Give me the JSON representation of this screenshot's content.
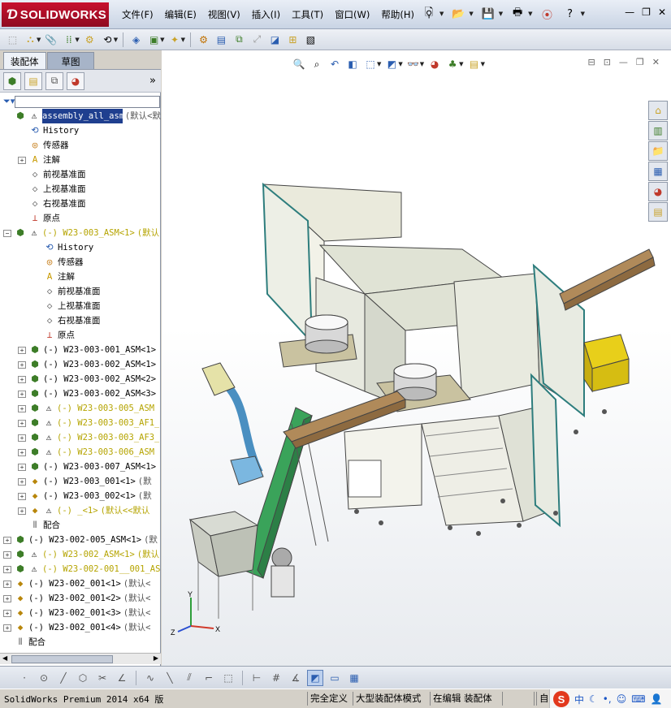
{
  "app": {
    "name": "SOLIDWORKS",
    "brand_color": "#c8102e"
  },
  "menu": {
    "items": [
      "文件(F)",
      "编辑(E)",
      "视图(V)",
      "插入(I)",
      "工具(T)",
      "窗口(W)",
      "帮助(H)"
    ]
  },
  "left_panel": {
    "tabs": [
      "装配体",
      "草图"
    ],
    "active_tab": "装配体",
    "tree": [
      {
        "depth": 0,
        "exp": "",
        "icon": "assembly",
        "warn": true,
        "label": "assembly_all_asm",
        "extra": "(默认<默",
        "selected": true
      },
      {
        "depth": 1,
        "exp": "",
        "icon": "history",
        "label": "History"
      },
      {
        "depth": 1,
        "exp": "",
        "icon": "sensor",
        "label": "传感器"
      },
      {
        "depth": 1,
        "exp": "+",
        "icon": "annotation",
        "label": "注解"
      },
      {
        "depth": 1,
        "exp": "",
        "icon": "plane",
        "label": "前视基准面"
      },
      {
        "depth": 1,
        "exp": "",
        "icon": "plane",
        "label": "上视基准面"
      },
      {
        "depth": 1,
        "exp": "",
        "icon": "plane",
        "label": "右视基准面"
      },
      {
        "depth": 1,
        "exp": "",
        "icon": "origin",
        "label": "原点"
      },
      {
        "depth": 0,
        "exp": "−",
        "icon": "assembly",
        "warn": true,
        "label": "(-) W23-003_ASM<1>",
        "extra": "(默认",
        "yellow": true
      },
      {
        "depth": 2,
        "exp": "",
        "icon": "history",
        "label": "History"
      },
      {
        "depth": 2,
        "exp": "",
        "icon": "sensor",
        "label": "传感器"
      },
      {
        "depth": 2,
        "exp": "",
        "icon": "annotation",
        "label": "注解"
      },
      {
        "depth": 2,
        "exp": "",
        "icon": "plane",
        "label": "前视基准面"
      },
      {
        "depth": 2,
        "exp": "",
        "icon": "plane",
        "label": "上视基准面"
      },
      {
        "depth": 2,
        "exp": "",
        "icon": "plane",
        "label": "右视基准面"
      },
      {
        "depth": 2,
        "exp": "",
        "icon": "origin",
        "label": "原点"
      },
      {
        "depth": 1,
        "exp": "+",
        "icon": "assembly",
        "label": "(-) W23-003-001_ASM<1>"
      },
      {
        "depth": 1,
        "exp": "+",
        "icon": "assembly",
        "label": "(-) W23-003-002_ASM<1>"
      },
      {
        "depth": 1,
        "exp": "+",
        "icon": "assembly",
        "label": "(-) W23-003-002_ASM<2>"
      },
      {
        "depth": 1,
        "exp": "+",
        "icon": "assembly",
        "label": "(-) W23-003-002_ASM<3>"
      },
      {
        "depth": 1,
        "exp": "+",
        "icon": "assembly",
        "warn": true,
        "label": "(-) W23-003-005_ASM",
        "yellow": true
      },
      {
        "depth": 1,
        "exp": "+",
        "icon": "assembly",
        "warn": true,
        "label": "(-) W23-003-003_AF1_",
        "yellow": true
      },
      {
        "depth": 1,
        "exp": "+",
        "icon": "assembly",
        "warn": true,
        "label": "(-) W23-003-003_AF3_",
        "yellow": true
      },
      {
        "depth": 1,
        "exp": "+",
        "icon": "assembly",
        "warn": true,
        "label": "(-) W23-003-006_ASM",
        "yellow": true
      },
      {
        "depth": 1,
        "exp": "+",
        "icon": "assembly",
        "label": "(-) W23-003-007_ASM<1>"
      },
      {
        "depth": 1,
        "exp": "+",
        "icon": "part",
        "label": "(-) W23-003_001<1>",
        "extra": "(默"
      },
      {
        "depth": 1,
        "exp": "+",
        "icon": "part",
        "label": "(-) W23-003_002<1>",
        "extra": "(默"
      },
      {
        "depth": 1,
        "exp": "+",
        "icon": "part",
        "warn": true,
        "label": "(-) _<1>",
        "extra": "(默认<<默认",
        "yellow": true
      },
      {
        "depth": 1,
        "exp": "",
        "icon": "mate",
        "label": "配合"
      },
      {
        "depth": 0,
        "exp": "+",
        "icon": "assembly",
        "label": "(-) W23-002-005_ASM<1>",
        "extra": "(默"
      },
      {
        "depth": 0,
        "exp": "+",
        "icon": "assembly",
        "warn": true,
        "label": "(-) W23-002_ASM<1>",
        "extra": "(默认",
        "yellow": true
      },
      {
        "depth": 0,
        "exp": "+",
        "icon": "assembly",
        "warn": true,
        "label": "(-) W23-002-001__001_AS",
        "yellow": true
      },
      {
        "depth": 0,
        "exp": "+",
        "icon": "part",
        "label": "(-) W23-002_001<1>",
        "extra": "(默认<"
      },
      {
        "depth": 0,
        "exp": "+",
        "icon": "part",
        "label": "(-) W23-002_001<2>",
        "extra": "(默认<"
      },
      {
        "depth": 0,
        "exp": "+",
        "icon": "part",
        "label": "(-) W23-002_001<3>",
        "extra": "(默认<"
      },
      {
        "depth": 0,
        "exp": "+",
        "icon": "part",
        "label": "(-) W23-002_001<4>",
        "extra": "(默认<"
      },
      {
        "depth": 0,
        "exp": "",
        "icon": "mate",
        "label": "配合"
      }
    ]
  },
  "statusbar": {
    "app_version": "SolidWorks Premium 2014 x64 版",
    "fields": [
      "完全定义",
      "大型装配体模式",
      "在编辑 装配体"
    ],
    "extra": "自定"
  },
  "ime": {
    "logo": "S",
    "mode": "中"
  },
  "triad": {
    "x": "X",
    "y": "Y",
    "z": "Z"
  }
}
